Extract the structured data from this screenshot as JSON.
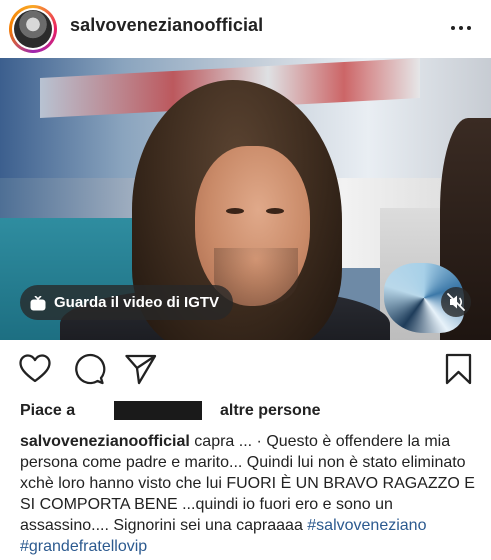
{
  "header": {
    "username": "salvovenezianoofficial",
    "more_icon": "more-horizontal-icon"
  },
  "media": {
    "igtv_label": "Guarda il video di IGTV",
    "igtv_icon": "igtv-icon",
    "mute_icon": "speaker-muted-icon"
  },
  "actions": {
    "like_icon": "heart-icon",
    "comment_icon": "comment-icon",
    "share_icon": "send-icon",
    "save_icon": "bookmark-icon"
  },
  "likes": {
    "prefix": "Piace a",
    "suffix": "altre persone"
  },
  "caption": {
    "username": "salvovenezianoofficial",
    "text": " capra ... · Questo è offendere la mia persona come padre e marito... Quindi lui non è stato eliminato xchè loro hanno visto che lui FUORI È UN BRAVO RAGAZZO E SI COMPORTA BENE ...quindi io fuori ero e sono un assassino.... Signorini sei una capraaaa ",
    "hashtag1": "#salvoveneziano",
    "hashtag2": "#grandefratellovip"
  },
  "colors": {
    "hashtag": "#2c5a8f",
    "text": "#222222"
  }
}
